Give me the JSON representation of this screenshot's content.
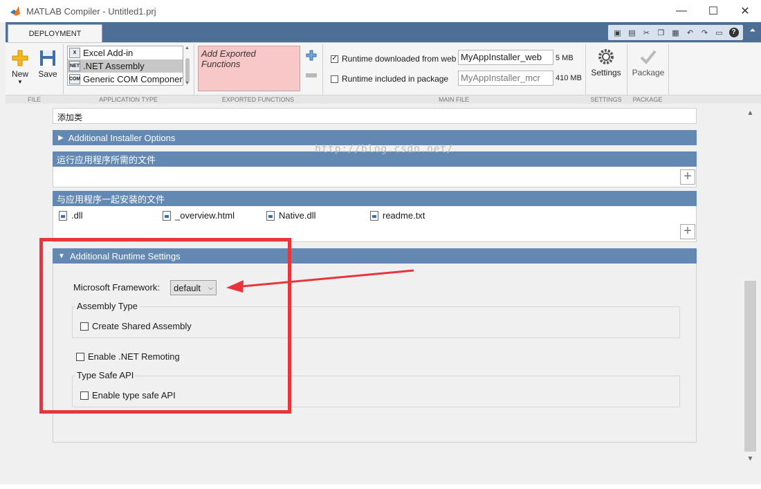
{
  "window": {
    "title": "MATLAB Compiler - Untitled1.prj",
    "minimize": "—",
    "maximize": "☐",
    "close": "✕"
  },
  "toolstrip": {
    "tab_label": "DEPLOYMENT",
    "file": {
      "new_label": "New",
      "save_label": "Save",
      "section_label": "FILE"
    },
    "application_type": {
      "items": [
        "Excel Add-in",
        ".NET Assembly",
        "Generic COM Component"
      ],
      "selected_index": 1,
      "section_label": "APPLICATION TYPE"
    },
    "exported_functions": {
      "placeholder": "Add Exported Functions",
      "section_label": "EXPORTED FUNCTIONS"
    },
    "main_file": {
      "runtime_web_label": "Runtime downloaded from web",
      "runtime_web_checked": true,
      "runtime_web_name": "MyAppInstaller_web",
      "runtime_web_size": "5 MB",
      "runtime_pkg_label": "Runtime included in package",
      "runtime_pkg_checked": false,
      "runtime_pkg_name": "MyAppInstaller_mcr",
      "runtime_pkg_size": "410 MB",
      "section_label": "MAIN FILE"
    },
    "settings": {
      "label": "Settings",
      "section_label": "SETTINGS"
    },
    "package": {
      "label": "Package",
      "section_label": "PACKAGE"
    }
  },
  "content": {
    "add_class_text": "添加类",
    "additional_installer_options": "Additional Installer Options",
    "files_required_header": "运行应用程序所需的文件",
    "files_installed_header": "与应用程序一起安装的文件",
    "installed_files": [
      ".dll",
      "_overview.html",
      "Native.dll",
      "readme.txt"
    ],
    "add_button": "+",
    "runtime_settings_header": "Additional Runtime Settings",
    "framework_label": "Microsoft Framework:",
    "framework_value": "default",
    "assembly_type_title": "Assembly Type",
    "create_shared_assembly_label": "Create Shared Assembly",
    "enable_remoting_label": "Enable .NET Remoting",
    "type_safe_title": "Type Safe API",
    "enable_type_safe_label": "Enable type safe API"
  },
  "watermark": "http://blog.csdn.net/",
  "colors": {
    "toolstrip_blue": "#4d6f96",
    "section_header": "#6389b3",
    "export_box": "#f8c8c8",
    "annotation_red": "#e8353b"
  }
}
